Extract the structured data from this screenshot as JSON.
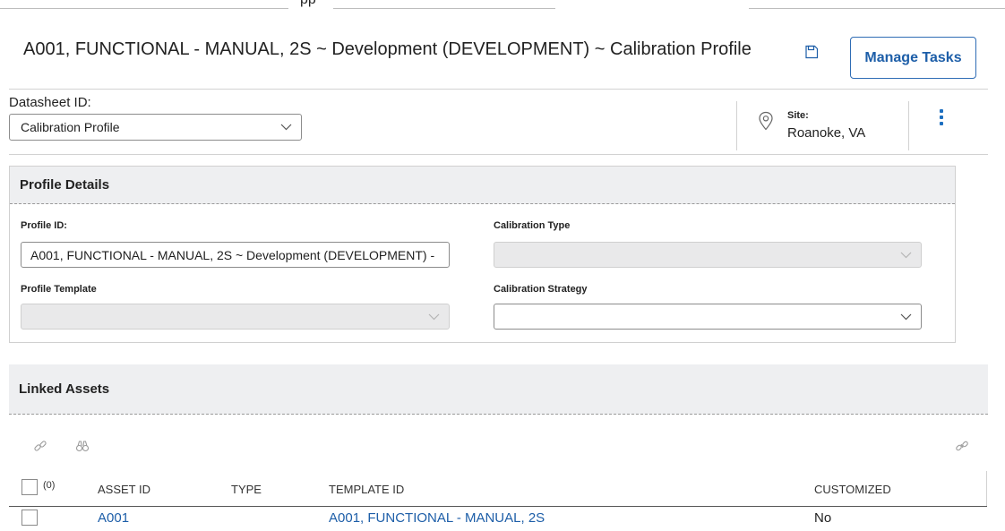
{
  "top_fragment": "pp",
  "title": "A001, FUNCTIONAL - MANUAL, 2S ~ Development (DEVELOPMENT) ~ Calibration Profile",
  "toolbar": {
    "save_icon": "save-icon",
    "manage_tasks_label": "Manage Tasks"
  },
  "datasheet": {
    "label": "Datasheet ID:",
    "value": "Calibration Profile"
  },
  "site": {
    "label": "Site:",
    "value": "Roanoke, VA"
  },
  "profile_details": {
    "heading": "Profile Details",
    "profile_id_label": "Profile ID:",
    "profile_id_value": "A001, FUNCTIONAL - MANUAL, 2S ~ Development (DEVELOPMENT) -",
    "calibration_type_label": "Calibration Type",
    "calibration_type_value": "",
    "profile_template_label": "Profile Template",
    "profile_template_value": "",
    "calibration_strategy_label": "Calibration Strategy",
    "calibration_strategy_value": ""
  },
  "linked_assets": {
    "heading": "Linked Assets",
    "select_count": "(0)",
    "columns": [
      "ASSET ID",
      "TYPE",
      "TEMPLATE ID",
      "CUSTOMIZED"
    ],
    "rows": [
      {
        "asset_id": "A001",
        "type": "",
        "template_id": "A001, FUNCTIONAL - MANUAL, 2S",
        "customized": "No"
      }
    ]
  },
  "colors": {
    "accent": "#1d5ea8",
    "panel_header_bg": "#eeeff1",
    "kebab": "#1d6fc0"
  }
}
